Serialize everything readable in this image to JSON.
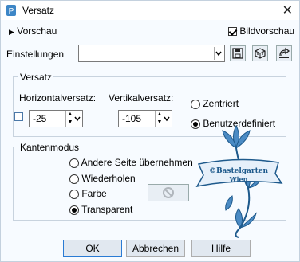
{
  "window": {
    "title": "Versatz",
    "close_glyph": "✕"
  },
  "preview": {
    "label": "Vorschau",
    "bild_label": "Bildvorschau",
    "bild_checked": true
  },
  "settings": {
    "label": "Einstellungen",
    "value": ""
  },
  "offset_group": {
    "legend": "Versatz",
    "horizontal": {
      "label": "Horizontalversatz:",
      "value": "-25"
    },
    "vertical": {
      "label": "Vertikalversatz:",
      "value": "-105"
    },
    "modes": [
      {
        "label": "Zentriert",
        "selected": false
      },
      {
        "label": "Benutzerdefiniert",
        "selected": true
      }
    ]
  },
  "edge_group": {
    "legend": "Kantenmodus",
    "options": [
      {
        "label": "Andere Seite übernehmen",
        "selected": false
      },
      {
        "label": "Wiederholen",
        "selected": false
      },
      {
        "label": "Farbe",
        "selected": false
      },
      {
        "label": "Transparent",
        "selected": true
      }
    ]
  },
  "watermark": {
    "text": "©Bastelgarten Wien"
  },
  "buttons": {
    "ok": "OK",
    "cancel": "Abbrechen",
    "help": "Hilfe"
  },
  "colors": {
    "accent": "#2a7bd4",
    "watermark": "#2d6fa6"
  }
}
